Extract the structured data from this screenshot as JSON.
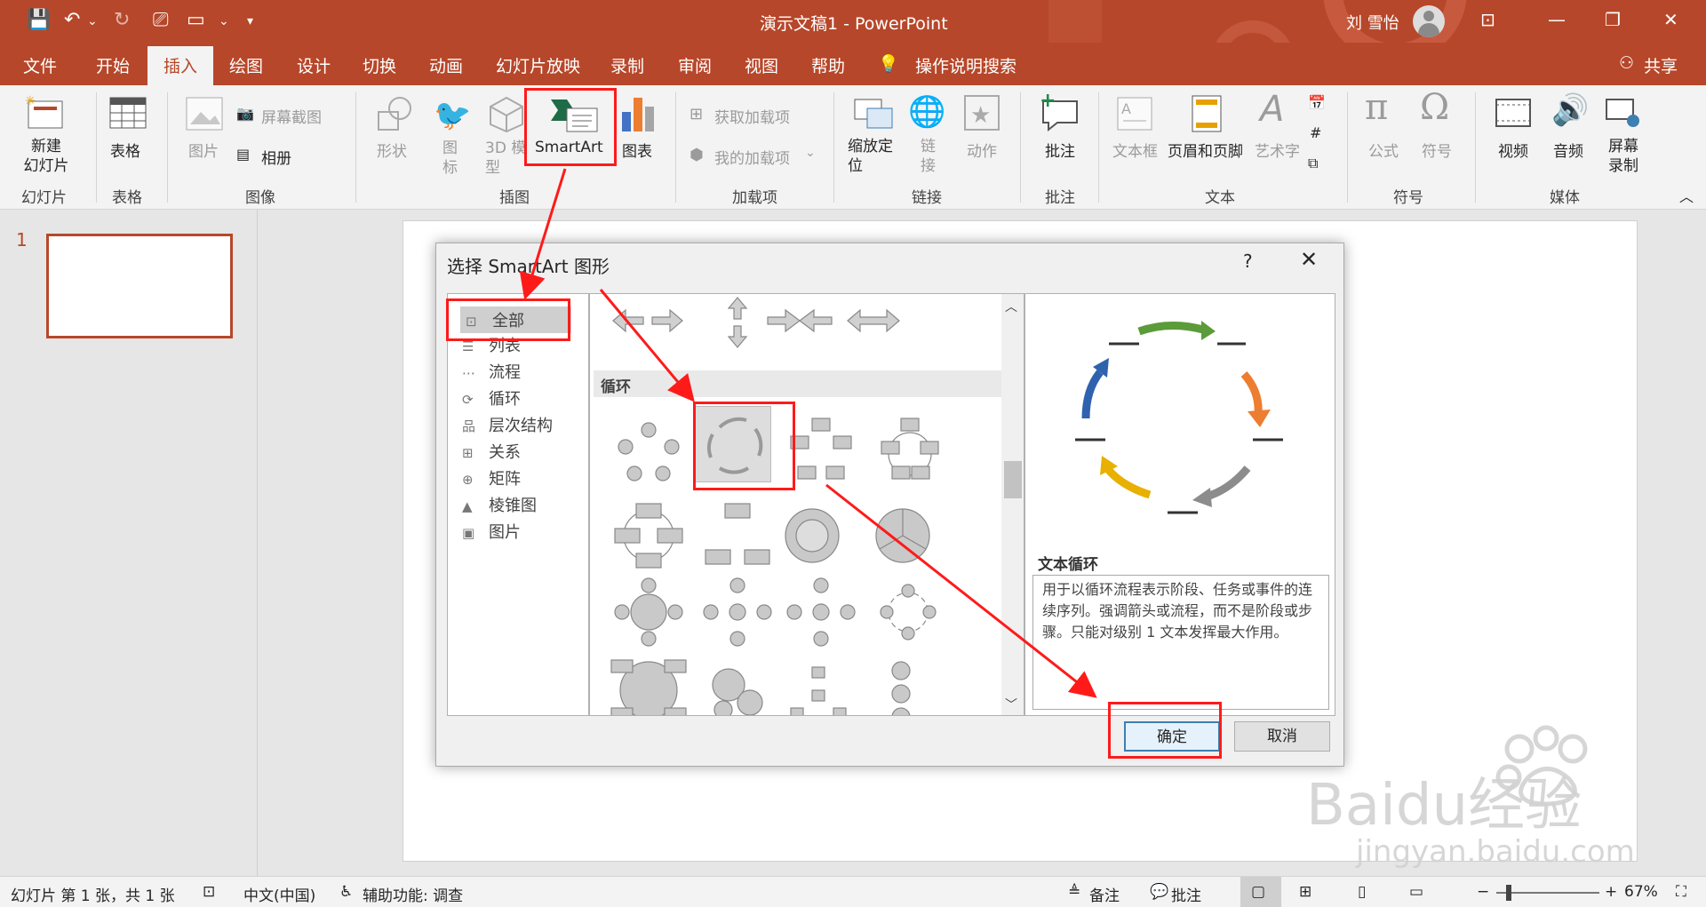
{
  "titlebar": {
    "doc_title": "演示文稿1  -  PowerPoint",
    "user": "刘 雪怡"
  },
  "tabs": [
    "文件",
    "开始",
    "插入",
    "绘图",
    "设计",
    "切换",
    "动画",
    "幻灯片放映",
    "录制",
    "审阅",
    "视图",
    "帮助"
  ],
  "tell_me": "操作说明搜索",
  "share": "共享",
  "ribbon": {
    "new_slide": "新建\n幻灯片",
    "table": "表格",
    "picture": "图片",
    "screenshot": "屏幕截图",
    "album": "相册",
    "shapes": "形状",
    "icons": "图\n标",
    "model3d": "3D 模\n型",
    "smartart": "SmartArt",
    "chart": "图表",
    "get_addins": "获取加载项",
    "my_addins": "我的加载项",
    "zoom": "缩放定\n位",
    "link": "链\n接",
    "action": "动作",
    "comment": "批注",
    "textbox": "文本框",
    "header_footer": "页眉和页脚",
    "wordart": "艺术字",
    "equation": "公式",
    "symbol": "符号",
    "video": "视频",
    "audio": "音频",
    "screen_rec": "屏幕\n录制",
    "groups": {
      "slides": "幻灯片",
      "tables": "表格",
      "images": "图像",
      "illustrations": "插图",
      "addins": "加载项",
      "links": "链接",
      "comments": "批注",
      "text": "文本",
      "symbols": "符号",
      "media": "媒体"
    }
  },
  "slide_number": "1",
  "dialog": {
    "title": "选择 SmartArt 图形",
    "help": "?",
    "close": "✕",
    "categories": [
      {
        "label": "全部",
        "icon": "⊡"
      },
      {
        "label": "列表",
        "icon": "☰"
      },
      {
        "label": "流程",
        "icon": "⋯"
      },
      {
        "label": "循环",
        "icon": "⟳"
      },
      {
        "label": "层次结构",
        "icon": "品"
      },
      {
        "label": "关系",
        "icon": "⊞"
      },
      {
        "label": "矩阵",
        "icon": "⊕"
      },
      {
        "label": "棱锥图",
        "icon": "▲"
      },
      {
        "label": "图片",
        "icon": "▣"
      }
    ],
    "section_header": "循环",
    "preview_name": "文本循环",
    "preview_desc": "用于以循环流程表示阶段、任务或事件的连续序列。强调箭头或流程，而不是阶段或步骤。只能对级别 1 文本发挥最大作用。",
    "ok": "确定",
    "cancel": "取消"
  },
  "status": {
    "slide_info": "幻灯片 第 1 张，共 1 张",
    "lang": "中文(中国)",
    "accessibility": "辅助功能: 调查",
    "notes": "备注",
    "comments": "批注",
    "zoom": "67%"
  },
  "watermark": {
    "brand": "Baidu经验",
    "url": "jingyan.baidu.com"
  },
  "colors": {
    "accent": "#b7472a",
    "highlight": "#ff1a1a"
  }
}
